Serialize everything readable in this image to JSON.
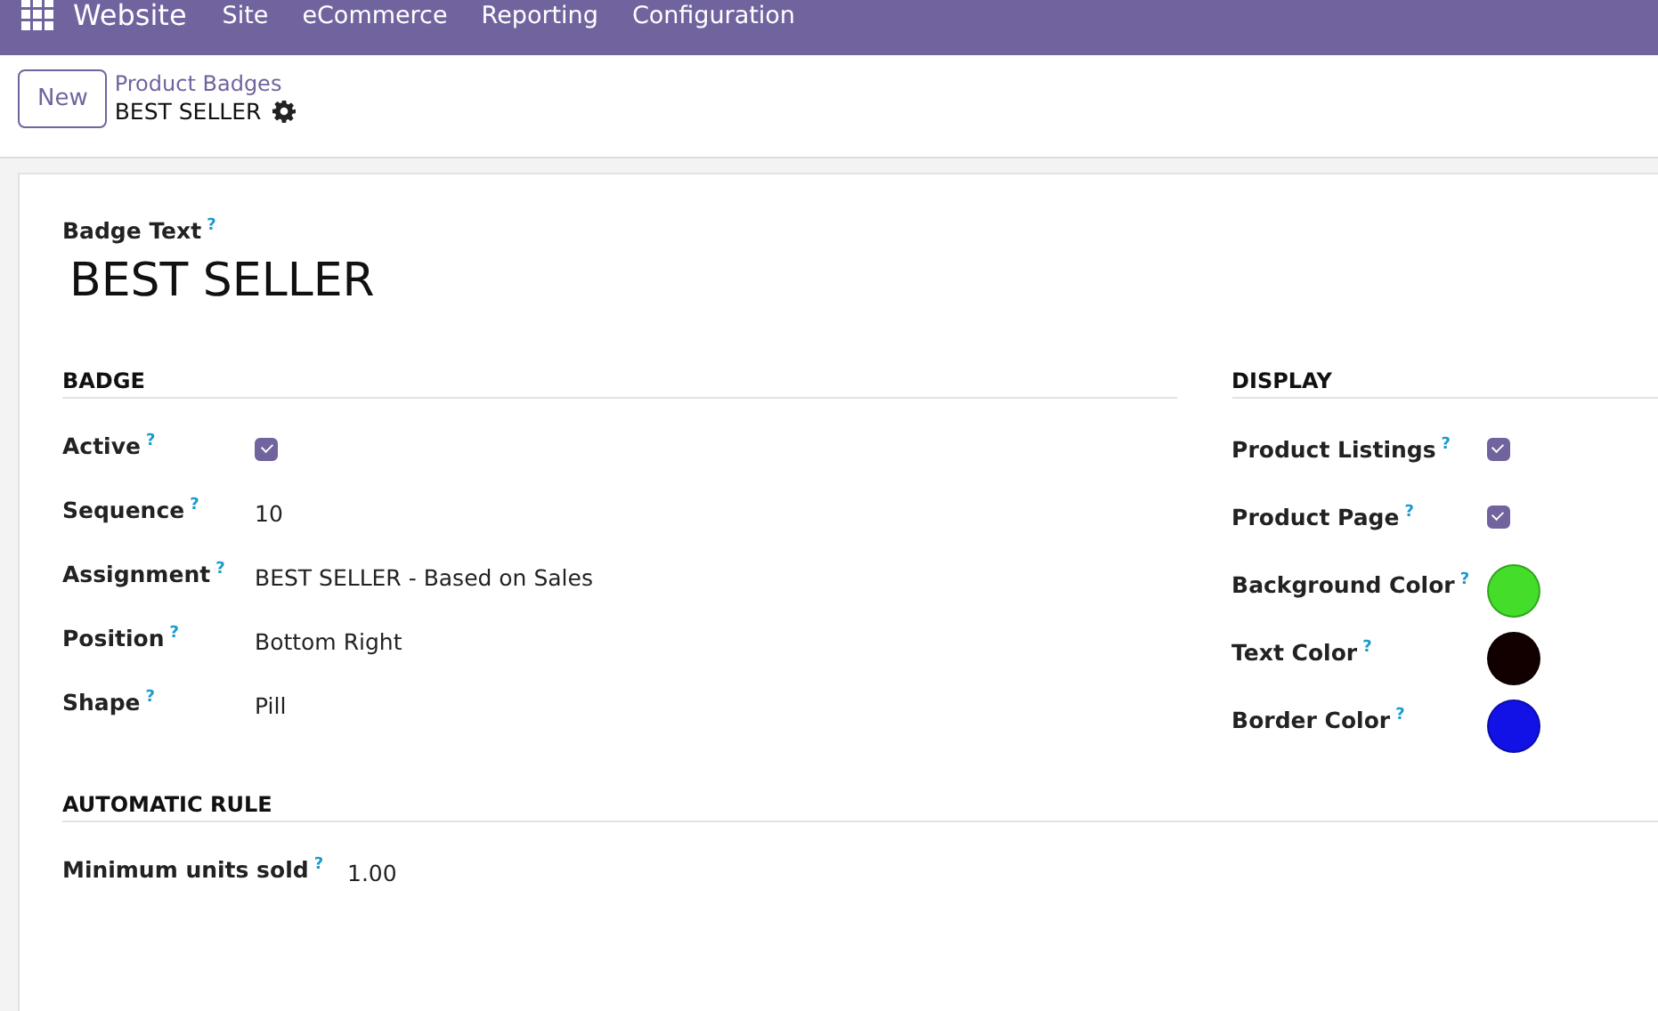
{
  "navbar": {
    "app": "Website",
    "menus": [
      "Site",
      "eCommerce",
      "Reporting",
      "Configuration"
    ]
  },
  "control_panel": {
    "new_button": "New",
    "breadcrumb": "Product Badges",
    "record": "BEST SELLER"
  },
  "form": {
    "title_label": "Badge Text",
    "title_help": "?",
    "title": "BEST SELLER",
    "groups": [
      {
        "heading": "BADGE",
        "fields": [
          {
            "kind": "checkbox",
            "label": "Active",
            "help": "?",
            "checked": true
          },
          {
            "kind": "text",
            "label": "Sequence",
            "help": "?",
            "value": "10"
          },
          {
            "kind": "text",
            "label": "Assignment",
            "help": "?",
            "value": "BEST SELLER - Based on Sales"
          },
          {
            "kind": "text",
            "label": "Position",
            "help": "?",
            "value": "Bottom Right"
          },
          {
            "kind": "text",
            "label": "Shape",
            "help": "?",
            "value": "Pill"
          }
        ]
      },
      {
        "heading": "DISPLAY",
        "fields": [
          {
            "kind": "checkbox",
            "label": "Product Listings",
            "help": "?",
            "checked": true
          },
          {
            "kind": "checkbox",
            "label": "Product Page",
            "help": "?",
            "checked": true
          },
          {
            "kind": "color",
            "label": "Background Color",
            "help": "?",
            "color": "#44dd2a"
          },
          {
            "kind": "color",
            "label": "Text Color",
            "help": "?",
            "color": "#120000"
          },
          {
            "kind": "color",
            "label": "Border Color",
            "help": "?",
            "color": "#1212e6"
          }
        ]
      }
    ],
    "rule": {
      "heading": "AUTOMATIC RULE",
      "fields": [
        {
          "kind": "text",
          "label": "Minimum units sold",
          "help": "?",
          "value": "1.00"
        }
      ]
    }
  }
}
